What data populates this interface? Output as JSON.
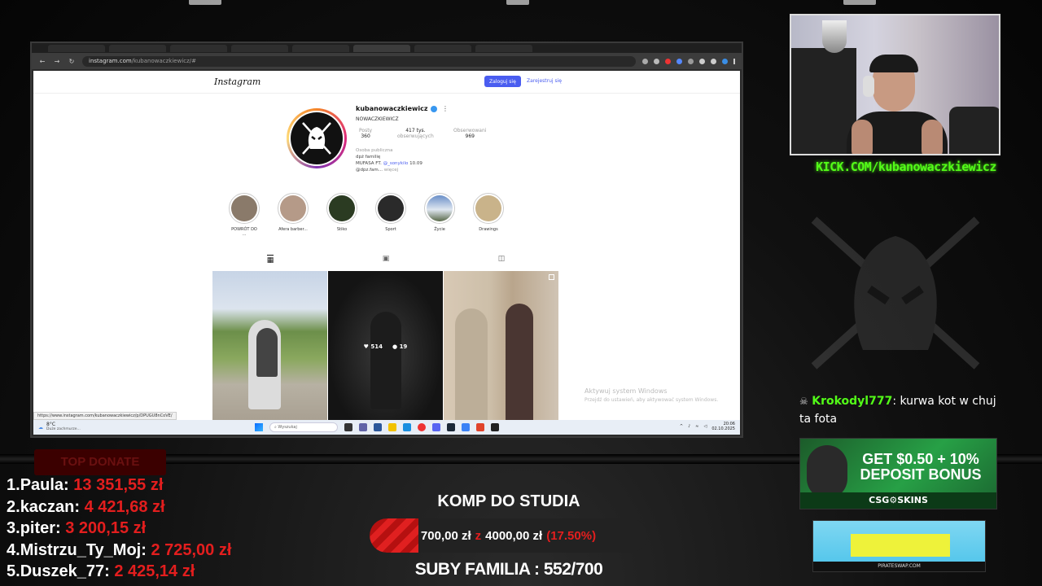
{
  "browser": {
    "url": "instagram.com",
    "url_path": "/kubanowaczkiewicz/#",
    "status_url": "https://www.instagram.com/kubanowaczkiewicz/p/DPUGU8nCoVE/"
  },
  "instagram": {
    "logo": "Instagram",
    "login_label": "Zaloguj się",
    "register_label": "Zarejestruj się",
    "username": "kubanowaczkiewicz",
    "display_name": "NOWACZKIEWICZ",
    "stats": [
      {
        "label": "Posty",
        "value": "360"
      },
      {
        "label": "obserwujących",
        "value": "417 tys."
      },
      {
        "label": "Obserwowani",
        "value": "969"
      }
    ],
    "bio": {
      "category": "Osoba publiczna",
      "line1": "dpż familię",
      "line2_prefix": "MUFASA FT.",
      "line2_link": "@_sonykilo",
      "line2_suffix": "10.09",
      "line3": "@dpz.fam...",
      "more": "więcej"
    },
    "highlights": [
      {
        "label": "POWRÓT DO ...",
        "color": "#8a7a6a"
      },
      {
        "label": "Afera barber...",
        "color": "#b59a88"
      },
      {
        "label": "Stiko",
        "color": "#2b3b22"
      },
      {
        "label": "Sport",
        "color": "#2a2a2a"
      },
      {
        "label": "Życie",
        "color": "#6a8fc8"
      },
      {
        "label": "Drawings",
        "color": "#c9b38a"
      }
    ],
    "post_likes": "514",
    "post_comments": "19",
    "watermark_title": "Aktywuj system Windows",
    "watermark_sub": "Przejdź do ustawień, aby aktywować system Windows."
  },
  "taskbar": {
    "temp": "8°C",
    "weather": "Duże zachmurze...",
    "search_placeholder": "Wyszukaj",
    "time": "20:06",
    "date": "02.10.2025"
  },
  "stream": {
    "kick_url": "KICK.COM/kubanowaczkiewicz",
    "chat_user": "Krokodyl777",
    "chat_message": ": kurwa kot w chuj ta fota",
    "ad_headline_1": "GET $0.50 + 10%",
    "ad_headline_2": "DEPOSIT BONUS",
    "ad_brand": "CSG⚙SKINS",
    "ad2_footer": "PIRATESWAP.COM",
    "top_donate_label": "TOP DONATE",
    "donations": [
      {
        "rank": "1.",
        "name": "Paula:",
        "amount": "13 351,55 zł"
      },
      {
        "rank": "2.",
        "name": "kaczan:",
        "amount": "4 421,68 zł"
      },
      {
        "rank": "3.",
        "name": "piter:",
        "amount": "3 200,15 zł"
      },
      {
        "rank": "4.",
        "name": "Mistrzu_Ty_Moj:",
        "amount": "2 725,00 zł"
      },
      {
        "rank": "5.",
        "name": "Duszek_77:",
        "amount": "2 425,14 zł"
      }
    ],
    "goal_title": "KOMP DO STUDIA",
    "goal_current": "700,00 zł",
    "goal_sep": "z",
    "goal_target": "4000,00 zł",
    "goal_percent": "(17.50%)",
    "goal_fraction": 0.175,
    "subs_text": "SUBY FAMILIA : 552/700"
  }
}
